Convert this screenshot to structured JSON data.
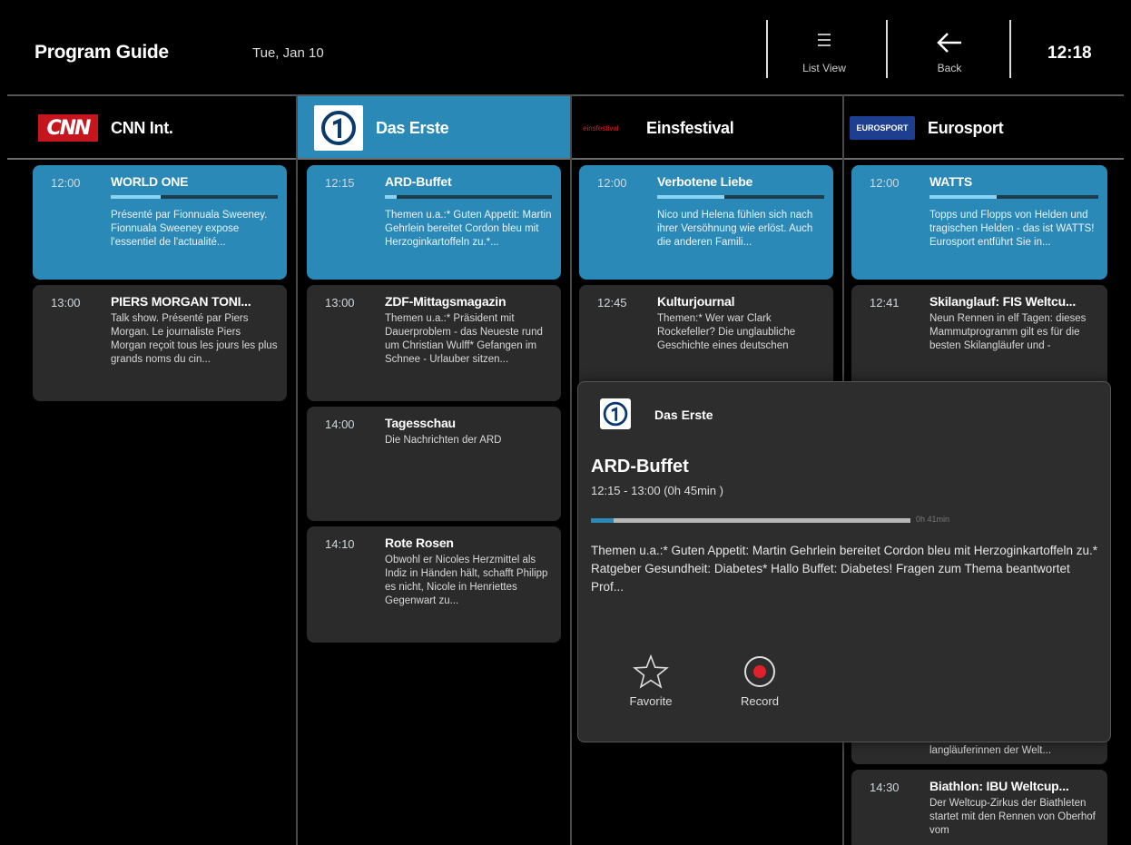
{
  "header": {
    "title": "Program Guide",
    "date": "Tue, Jan 10",
    "list_view_label": "List View",
    "back_label": "Back",
    "clock": "12:18"
  },
  "channels": [
    {
      "name": "CNN Int.",
      "logo_text": "CNN"
    },
    {
      "name": "Das Erste",
      "logo_text": "1"
    },
    {
      "name": "Einsfestival",
      "logo_text": "einsfestival"
    },
    {
      "name": "Eurosport",
      "logo_text": "EUROSPORT"
    }
  ],
  "columns": [
    {
      "programs": [
        {
          "time": "12:00",
          "title": "WORLD ONE",
          "desc": "Présenté par Fionnuala Sweeney. Fionnuala Sweeney expose l'essentiel de l'actualité...",
          "progress": 0.3
        },
        {
          "time": "13:00",
          "title": "PIERS MORGAN TONI...",
          "desc": "Talk show. Présenté par Piers Morgan. Le journaliste Piers Morgan reçoit tous les jours les plus grands noms du cin..."
        }
      ]
    },
    {
      "programs": [
        {
          "time": "12:15",
          "title": "ARD-Buffet",
          "desc": "Themen u.a.:* Guten Appetit: Martin Gehrlein bereitet Cordon bleu mit Herzoginkartoffeln zu.*...",
          "progress": 0.07
        },
        {
          "time": "13:00",
          "title": "ZDF-Mittagsmagazin",
          "desc": "Themen u.a.:* Präsident mit Dauerproblem - das Neueste rund um Christian Wulff* Gefangen im Schnee - Urlauber sitzen..."
        },
        {
          "time": "14:00",
          "title": "Tagesschau",
          "desc": "Die Nachrichten der ARD"
        },
        {
          "time": "14:10",
          "title": "Rote Rosen",
          "desc": "Obwohl er Nicoles Herzmittel als Indiz in Händen hält, schafft Philipp es nicht, Nicole in Henriettes Gegenwart zu..."
        }
      ]
    },
    {
      "programs": [
        {
          "time": "12:00",
          "title": "Verbotene Liebe",
          "desc": "Nico und Helena fühlen sich nach ihrer Versöhnung wie erlöst. Auch die anderen Famili...",
          "progress": 0.4
        },
        {
          "time": "12:45",
          "title": "Kulturjournal",
          "desc": "Themen:* Wer war Clark Rockefeller? Die unglaubliche Geschichte eines deutschen"
        }
      ]
    },
    {
      "programs": [
        {
          "time": "12:00",
          "title": "WATTS",
          "desc": "Topps und Flopps von Helden und tragischen Helden - das ist WATTS! Eurosport entführt Sie in...",
          "progress": 0.4
        },
        {
          "time": "12:41",
          "title": "Skilanglauf: FIS Weltcu...",
          "desc": "Neun Rennen in elf Tagen: dieses Mammutprogramm gilt es für die besten Skilangläufer und -"
        },
        {
          "time": "",
          "title": "",
          "desc": "langläuferinnen der Welt..."
        },
        {
          "time": "14:30",
          "title": "Biathlon: IBU Weltcup...",
          "desc": "Der Weltcup-Zirkus der Biathleten startet mit den Rennen von Oberhof vom"
        }
      ]
    }
  ],
  "popup": {
    "channel": "Das Erste",
    "title": "ARD-Buffet",
    "time": "12:15 - 13:00 (0h 45min )",
    "progress": 0.07,
    "remaining": "0h 41min",
    "desc": "Themen u.a.:* Guten Appetit: Martin Gehrlein bereitet Cordon bleu mit Herzoginkartoffeln zu.* Ratgeber Gesundheit: Diabetes* Hallo Buffet: Diabetes! Fragen zum Thema beantwortet Prof...",
    "favorite_label": "Favorite",
    "record_label": "Record"
  },
  "colors": {
    "accent": "#2a89b6",
    "card": "#2b2b2b",
    "record_red": "#e0202a"
  }
}
